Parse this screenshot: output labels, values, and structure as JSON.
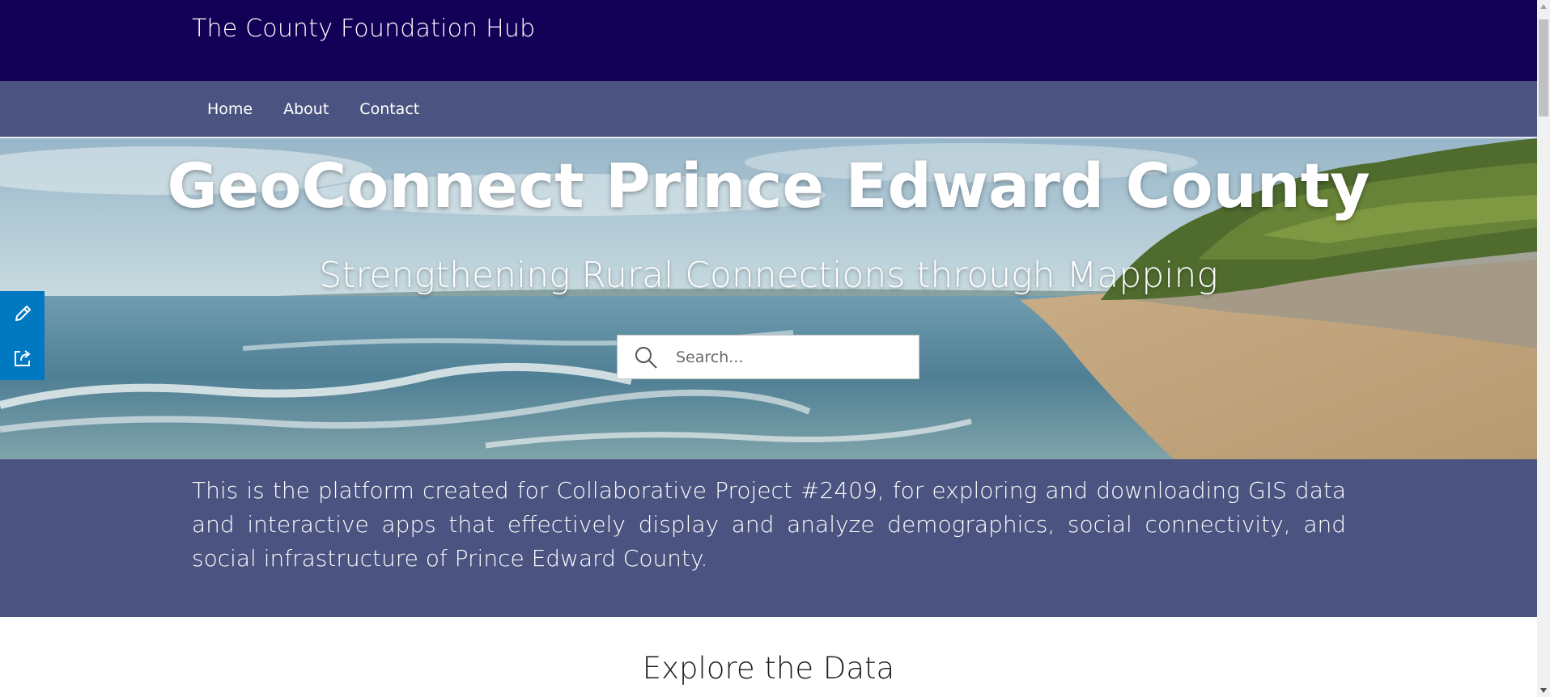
{
  "header": {
    "site_title": "The County Foundation Hub"
  },
  "nav": {
    "items": [
      {
        "label": "Home"
      },
      {
        "label": "About"
      },
      {
        "label": "Contact"
      }
    ]
  },
  "hero": {
    "title": "GeoConnect Prince Edward County",
    "subtitle": "Strengthening Rural Connections through Mapping",
    "search": {
      "placeholder": "Search...",
      "icon": "search-icon"
    },
    "background_image": "beach-lake-shoreline-photo"
  },
  "side_tools": {
    "items": [
      {
        "icon": "pencil-icon"
      },
      {
        "icon": "share-icon"
      }
    ]
  },
  "intro": {
    "text": "This is the platform created for Collaborative Project #2409, for exploring and downloading GIS data and interactive apps that effectively display and analyze demographics, social connectivity, and social infrastructure of Prince Edward County."
  },
  "explore": {
    "title": "Explore the Data"
  },
  "colors": {
    "header_bg": "#110055",
    "nav_bg": "#4b5480",
    "intro_bg": "#4b5480",
    "side_tools_bg": "#0079c1"
  }
}
